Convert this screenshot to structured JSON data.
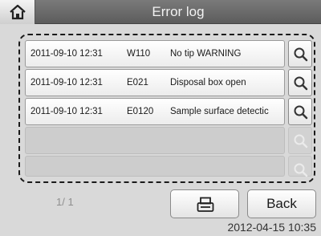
{
  "header": {
    "title": "Error log",
    "home_icon": "home-icon"
  },
  "log": {
    "entries": [
      {
        "date": "2011-09-10 12:31",
        "code": "W110",
        "message": "No tip WARNING"
      },
      {
        "date": "2011-09-10 12:31",
        "code": "E021",
        "message": "Disposal box open"
      },
      {
        "date": "2011-09-10 12:31",
        "code": "E0120",
        "message": "Sample surface detectic"
      }
    ],
    "empty_rows": 2
  },
  "pager": {
    "text": "1/ 1"
  },
  "buttons": {
    "print_icon": "printer-icon",
    "back_label": "Back"
  },
  "status": {
    "datetime": "2012-04-15 10:35"
  }
}
